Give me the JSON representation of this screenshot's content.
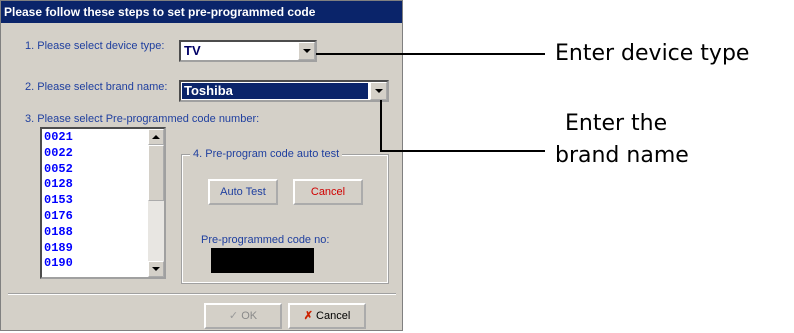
{
  "dialog": {
    "title": "Please follow these steps to set pre-programmed code",
    "step1_label": "1. Please select device type:",
    "device_type_value": "TV",
    "step2_label": "2. Please select brand name:",
    "brand_name_value": "Toshiba",
    "step3_label": "3. Please select Pre-programmed code number:",
    "codes": [
      "0021",
      "0022",
      "0052",
      "0128",
      "0153",
      "0176",
      "0188",
      "0189",
      "0190"
    ],
    "group_title": "4. Pre-program code auto test",
    "auto_test_label": "Auto Test",
    "group_cancel_label": "Cancel",
    "code_no_label": "Pre-programmed code no:",
    "ok_label": "OK",
    "cancel_label": "Cancel"
  },
  "annotations": {
    "device_type": "Enter device type",
    "brand_line1": "Enter the",
    "brand_line2": "brand name"
  },
  "colors": {
    "title_bar": "#0a246a",
    "label_text": "#1f3f9f",
    "list_text": "#0000ff",
    "cancel_red": "#d00000",
    "cancel_x": "#cc2200"
  },
  "icons": {
    "ok": "checkmark-icon",
    "cancel": "x-mark-icon"
  }
}
